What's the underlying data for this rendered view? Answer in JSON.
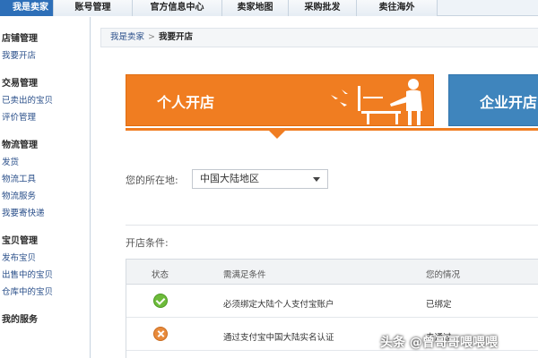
{
  "topnav": {
    "tabs": [
      {
        "label": "我是卖家"
      },
      {
        "label": "账号管理"
      },
      {
        "label": "官方信息中心"
      },
      {
        "label": "卖家地图"
      },
      {
        "label": "采购批发"
      },
      {
        "label": "卖往海外"
      }
    ]
  },
  "sidebar": {
    "groups": [
      {
        "title": "店铺管理",
        "items": [
          "我要开店"
        ]
      },
      {
        "title": "交易管理",
        "items": [
          "已卖出的宝贝",
          "评价管理"
        ]
      },
      {
        "title": "物流管理",
        "items": [
          "发货",
          "物流工具",
          "物流服务",
          "我要寄快递"
        ]
      },
      {
        "title": "宝贝管理",
        "items": [
          "发布宝贝",
          "出售中的宝贝",
          "仓库中的宝贝"
        ]
      },
      {
        "title": "我的服务",
        "items": []
      }
    ]
  },
  "breadcrumb": {
    "parent": "我是卖家",
    "separator": ">",
    "current": "我要开店"
  },
  "banners": {
    "personal": "个人开店",
    "company": "企业开店"
  },
  "location": {
    "label": "您的所在地:",
    "value": "中国大陆地区"
  },
  "conditions": {
    "label": "开店条件:",
    "headers": {
      "status": "状态",
      "requirement": "需满足条件",
      "result": "您的情况"
    },
    "rows": [
      {
        "status": "ok",
        "requirement": "必须绑定大陆个人支付宝账户",
        "result": "已绑定"
      },
      {
        "status": "fail",
        "requirement": "通过支付宝中国大陆实名认证",
        "result": "未通过"
      }
    ]
  },
  "watermark": "头条 @曾哥哥喂喂喂",
  "colors": {
    "accent_orange": "#f07d21",
    "accent_blue": "#3f85bd",
    "nav_active": "#2d6fb8"
  }
}
